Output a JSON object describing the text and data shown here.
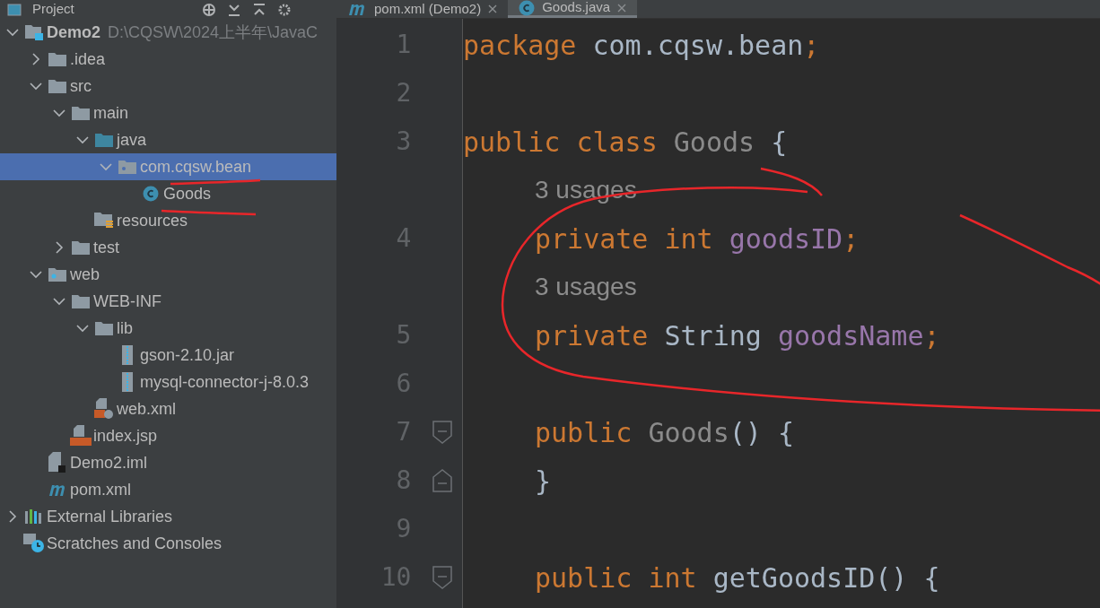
{
  "project_panel": {
    "title": "Project"
  },
  "tree": [
    {
      "label": "Demo2",
      "path": "D:\\CQSW\\2024上半年\\JavaC",
      "kind": "module",
      "expanded": true,
      "selected": false,
      "children": [
        {
          "label": ".idea",
          "kind": "folder",
          "expanded": false,
          "selected": false
        },
        {
          "label": "src",
          "kind": "folder",
          "expanded": true,
          "selected": false,
          "children": [
            {
              "label": "main",
              "kind": "folder",
              "expanded": true,
              "selected": false,
              "children": [
                {
                  "label": "java",
                  "kind": "source",
                  "expanded": true,
                  "selected": false,
                  "children": [
                    {
                      "label": "com.cqsw.bean",
                      "kind": "package",
                      "expanded": true,
                      "selected": true,
                      "children": [
                        {
                          "label": "Goods",
                          "kind": "class",
                          "selected": false
                        }
                      ]
                    }
                  ]
                },
                {
                  "label": "resources",
                  "kind": "resources",
                  "selected": false
                }
              ]
            },
            {
              "label": "test",
              "kind": "folder",
              "expanded": false,
              "selected": false
            }
          ]
        },
        {
          "label": "web",
          "kind": "web",
          "expanded": true,
          "selected": false,
          "children": [
            {
              "label": "WEB-INF",
              "kind": "folder",
              "expanded": true,
              "selected": false,
              "children": [
                {
                  "label": "lib",
                  "kind": "folder",
                  "expanded": true,
                  "selected": false,
                  "children": [
                    {
                      "label": "gson-2.10.jar",
                      "kind": "jar",
                      "selected": false
                    },
                    {
                      "label": "mysql-connector-j-8.0.3",
                      "kind": "jar",
                      "selected": false
                    }
                  ]
                },
                {
                  "label": "web.xml",
                  "kind": "xml",
                  "selected": false
                }
              ]
            },
            {
              "label": "index.jsp",
              "kind": "jsp",
              "selected": false
            }
          ]
        },
        {
          "label": "Demo2.iml",
          "kind": "iml",
          "selected": false
        },
        {
          "label": "pom.xml",
          "kind": "maven",
          "selected": false
        }
      ]
    },
    {
      "label": "External Libraries",
      "kind": "libraries",
      "expanded": false,
      "selected": false
    },
    {
      "label": "Scratches and Consoles",
      "kind": "scratches",
      "selected": false
    }
  ],
  "tabs": [
    {
      "label": "pom.xml (Demo2)",
      "kind": "maven",
      "selected": false
    },
    {
      "label": "Goods.java",
      "kind": "class",
      "selected": true
    }
  ],
  "editor": {
    "lines": [
      {
        "kind": "code",
        "number": "1",
        "indent": false,
        "tokens": [
          {
            "text": "package",
            "kind": "keyword"
          },
          {
            "text": " com.cqsw.bean",
            "kind": "plain"
          },
          {
            "text": ";",
            "kind": "keyword"
          }
        ]
      },
      {
        "kind": "code",
        "number": "2"
      },
      {
        "kind": "code",
        "number": "3",
        "indent": false,
        "tokens": [
          {
            "text": "public class",
            "kind": "keyword"
          },
          {
            "text": " Goods",
            "kind": "unused"
          },
          {
            "text": " {",
            "kind": "plain"
          }
        ]
      },
      {
        "kind": "hint",
        "text": "3 usages"
      },
      {
        "kind": "code",
        "number": "4",
        "indent": true,
        "tokens": [
          {
            "text": "private int",
            "kind": "keyword"
          },
          {
            "text": " goodsID",
            "kind": "field"
          },
          {
            "text": ";",
            "kind": "keyword"
          }
        ]
      },
      {
        "kind": "hint",
        "text": "3 usages"
      },
      {
        "kind": "code",
        "number": "5",
        "indent": true,
        "tokens": [
          {
            "text": "private",
            "kind": "keyword"
          },
          {
            "text": " String ",
            "kind": "plain"
          },
          {
            "text": "goodsName",
            "kind": "field"
          },
          {
            "text": ";",
            "kind": "keyword"
          }
        ]
      },
      {
        "kind": "code",
        "number": "6"
      },
      {
        "kind": "code",
        "number": "7",
        "indent": true,
        "fold_start": true,
        "tokens": [
          {
            "text": "public",
            "kind": "keyword"
          },
          {
            "text": " Goods",
            "kind": "unused"
          },
          {
            "text": "() {",
            "kind": "plain"
          }
        ]
      },
      {
        "kind": "code",
        "number": "8",
        "indent": true,
        "fold_end": true,
        "tokens": [
          {
            "text": "}",
            "kind": "plain"
          }
        ]
      },
      {
        "kind": "code",
        "number": "9"
      },
      {
        "kind": "code",
        "number": "10",
        "indent": true,
        "fold_start": true,
        "tokens": [
          {
            "text": "public int",
            "kind": "keyword"
          },
          {
            "text": " getGoodsID",
            "kind": "method"
          },
          {
            "text": "() {",
            "kind": "plain"
          }
        ]
      }
    ]
  }
}
